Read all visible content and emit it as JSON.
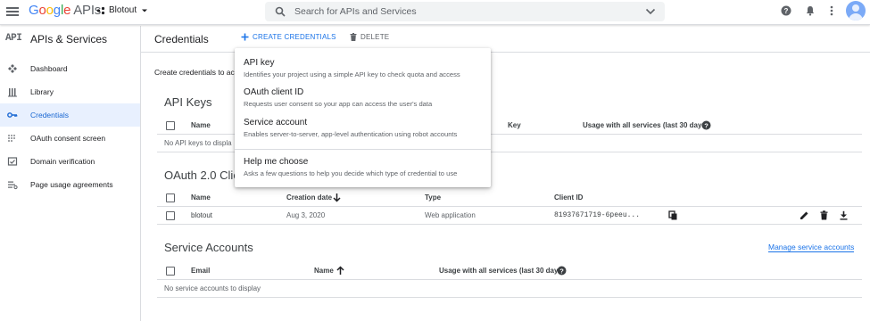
{
  "topbar": {
    "logo_letters": [
      "G",
      "o",
      "o",
      "g",
      "l",
      "e"
    ],
    "logo_suffix": "APIs",
    "project_name": "Blotout",
    "search_placeholder": "Search for APIs and Services",
    "icons": [
      "menu-icon",
      "project-dots-icon",
      "search-icon",
      "chevron-down-icon",
      "help-icon",
      "notifications-icon",
      "more-vert-icon",
      "account-avatar-icon"
    ]
  },
  "sidebar": {
    "badge": "API",
    "title": "APIs & Services",
    "items": [
      {
        "label": "Dashboard",
        "icon": "dashboard-icon"
      },
      {
        "label": "Library",
        "icon": "library-icon"
      },
      {
        "label": "Credentials",
        "icon": "key-icon",
        "active": true
      },
      {
        "label": "OAuth consent screen",
        "icon": "consent-icon"
      },
      {
        "label": "Domain verification",
        "icon": "domain-verification-icon"
      },
      {
        "label": "Page usage agreements",
        "icon": "settings-list-icon"
      }
    ]
  },
  "header": {
    "title": "Credentials",
    "create_label": "CREATE CREDENTIALS",
    "delete_label": "DELETE"
  },
  "intro_text": "Create credentials to acc",
  "api_keys": {
    "title": "API Keys",
    "columns": [
      "Name",
      "Key",
      "Usage with all services (last 30 days)"
    ],
    "empty": "No API keys to displa"
  },
  "oauth": {
    "title": "OAuth 2.0 Clie",
    "columns": [
      "Name",
      "Creation date",
      "Type",
      "Client ID"
    ],
    "rows": [
      {
        "name": "blotout",
        "date": "Aug 3, 2020",
        "type": "Web application",
        "client_id": "81937671719-6peeu..."
      }
    ]
  },
  "service_accounts": {
    "title": "Service Accounts",
    "manage_link": "Manage service accounts",
    "columns": [
      "Email",
      "Name",
      "Usage with all services (last 30 days)"
    ],
    "empty": "No service accounts to display"
  },
  "menu": {
    "items": [
      {
        "title": "API key",
        "desc": "Identifies your project using a simple API key to check quota and access"
      },
      {
        "title": "OAuth client ID",
        "desc": "Requests user consent so your app can access the user's data"
      },
      {
        "title": "Service account",
        "desc": "Enables server-to-server, app-level authentication using robot accounts"
      },
      {
        "title": "Help me choose",
        "desc": "Asks a few questions to help you decide which type of credential to use"
      }
    ]
  },
  "colors": {
    "accent": "#1a73e8",
    "active_bg": "#e8f0fe",
    "divider": "#dadce0",
    "text_secondary": "#5f6368"
  }
}
